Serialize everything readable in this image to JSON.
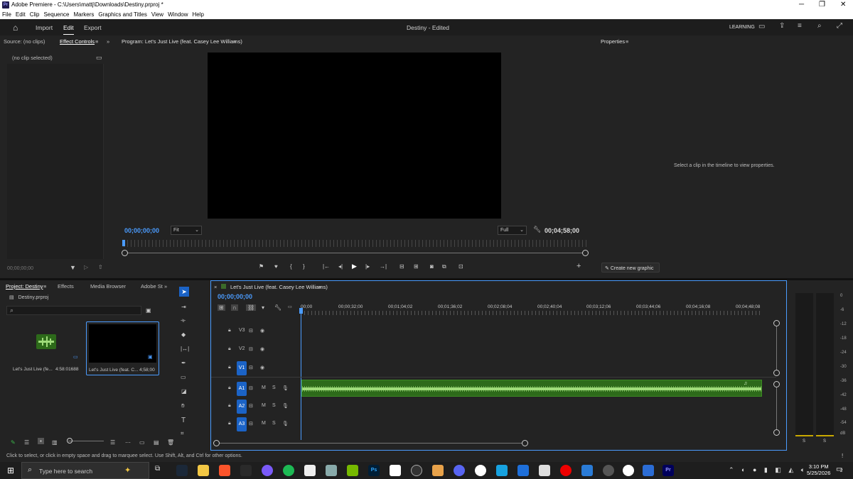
{
  "window": {
    "title": "Adobe Premiere - C:\\Users\\mattj\\Downloads\\Destiny.prproj *",
    "app_badge": "Pr"
  },
  "menu": [
    "File",
    "Edit",
    "Clip",
    "Sequence",
    "Markers",
    "Graphics and Titles",
    "View",
    "Window",
    "Help"
  ],
  "header": {
    "workspaces": [
      "Import",
      "Edit",
      "Export"
    ],
    "active_workspace": "Edit",
    "project_title": "Destiny",
    "project_status": "- Edited",
    "learning_label": "LEARNING"
  },
  "source_panel": {
    "tab_source": "Source: (no clips)",
    "tab_effect_controls": "Effect Controls",
    "no_clip": "(no clip selected)",
    "timecode": "00;00;00;00"
  },
  "program_monitor": {
    "title": "Program: Let's Just Live (feat. Casey Lee Williams)",
    "timecode_current": "00;00;00;00",
    "fit": "Fit",
    "resolution": "Full",
    "timecode_duration": "00;04;58;00"
  },
  "properties": {
    "title": "Properties",
    "empty_message": "Select a clip in the timeline to view properties.",
    "create_graphic": "Create new graphic"
  },
  "project_panel": {
    "tabs": [
      "Project: Destiny",
      "Effects",
      "Media Browser",
      "Adobe St"
    ],
    "file": "Destiny.prproj",
    "items": [
      {
        "name": "Let's Just Live (fe...",
        "duration": "4:58:01688"
      },
      {
        "name": "Let's Just Live (feat. C...",
        "duration": "4;58;00"
      }
    ]
  },
  "timeline": {
    "sequence_name": "Let's Just Live (feat. Casey Lee Williams)",
    "timecode": "00;00;00;00",
    "ruler": [
      "00;00",
      "00;00;32;00",
      "00;01;04;02",
      "00;01;36;02",
      "00;02;08;04",
      "00;02;40;04",
      "00;03;12;06",
      "00;03;44;06",
      "00;04;16;08",
      "00;04;48;08"
    ],
    "tracks": [
      {
        "id": "V3",
        "kind": "video"
      },
      {
        "id": "V2",
        "kind": "video"
      },
      {
        "id": "V1",
        "kind": "video",
        "targeted": true
      },
      {
        "id": "A1",
        "kind": "audio",
        "targeted": true
      },
      {
        "id": "A2",
        "kind": "audio",
        "targeted": true
      },
      {
        "id": "A3",
        "kind": "audio",
        "targeted": true
      }
    ],
    "mute_label": "M",
    "solo_label": "S"
  },
  "audio_meter": {
    "scale": [
      "0",
      "-6",
      "-12",
      "-18",
      "-24",
      "-30",
      "-36",
      "-42",
      "-48",
      "-54",
      "dB"
    ],
    "channels": [
      "S",
      "S"
    ]
  },
  "status_bar": {
    "hint": "Click to select, or click in empty space and drag to marquee select. Use Shift, Alt, and Ctrl for other options."
  },
  "taskbar": {
    "search_placeholder": "Type here to search",
    "time": "3:10 PM",
    "date": "5/25/2026",
    "notification_count": "2",
    "ps_label": "Ps",
    "pr_label": "Pr"
  },
  "colors": {
    "accent_blue": "#4b9cff",
    "track_target": "#1b63c6",
    "audio_clip": "#2d6a1a",
    "waveform": "#9fdc7a"
  }
}
